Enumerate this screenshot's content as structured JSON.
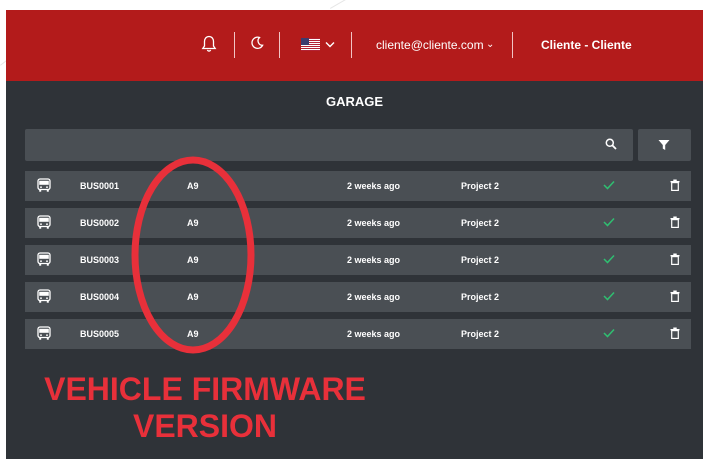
{
  "header": {
    "notification_icon": "bell-icon",
    "theme_icon": "moon-icon",
    "language_flag": "us-flag-icon",
    "email": "cliente@cliente.com",
    "user": "Cliente  -  Cliente"
  },
  "page": {
    "title": "GARAGE"
  },
  "search": {
    "value": "",
    "icon": "search-icon"
  },
  "filter": {
    "icon": "filter-icon"
  },
  "rows": [
    {
      "id": "BUS0001",
      "firmware": "A9",
      "time": "2 weeks ago",
      "project": "Project 2",
      "active": true
    },
    {
      "id": "BUS0002",
      "firmware": "A9",
      "time": "2 weeks ago",
      "project": "Project 2",
      "active": true
    },
    {
      "id": "BUS0003",
      "firmware": "A9",
      "time": "2 weeks ago",
      "project": "Project 2",
      "active": true
    },
    {
      "id": "BUS0004",
      "firmware": "A9",
      "time": "2 weeks ago",
      "project": "Project 2",
      "active": true
    },
    {
      "id": "BUS0005",
      "firmware": "A9",
      "time": "2 weeks ago",
      "project": "Project 2",
      "active": true
    }
  ],
  "annotation": {
    "line1": "VEHICLE FIRMWARE",
    "line2": "VERSION"
  },
  "colors": {
    "header_bg": "#b31b1b",
    "main_bg": "#2f3338",
    "row_bg": "#4a4f54",
    "check": "#2fbf71",
    "annotation": "#e8303a"
  }
}
